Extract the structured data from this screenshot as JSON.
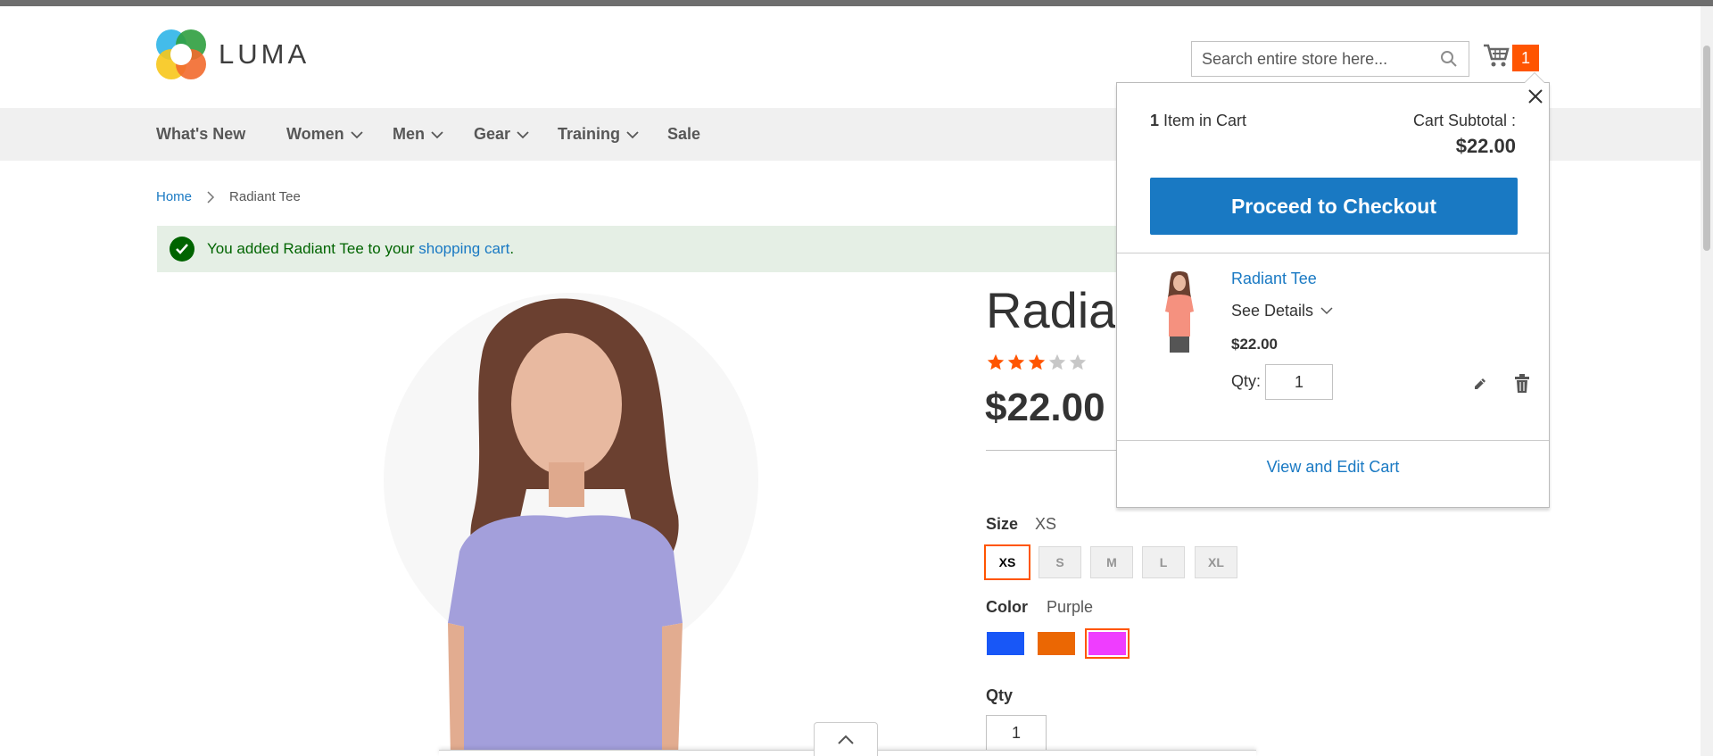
{
  "header": {
    "logo_text": "LUMA",
    "search": {
      "placeholder": "Search entire store here..."
    },
    "cart_count": "1"
  },
  "nav": {
    "items": [
      {
        "label": "What's New",
        "has_dropdown": false
      },
      {
        "label": "Women",
        "has_dropdown": true
      },
      {
        "label": "Men",
        "has_dropdown": true
      },
      {
        "label": "Gear",
        "has_dropdown": true
      },
      {
        "label": "Training",
        "has_dropdown": true
      },
      {
        "label": "Sale",
        "has_dropdown": false
      }
    ]
  },
  "breadcrumb": {
    "home": "Home",
    "current": "Radiant Tee"
  },
  "message": {
    "text_before": "You added Radiant Tee to your ",
    "link": "shopping cart",
    "text_after": "."
  },
  "product": {
    "title": "Radiant Tee",
    "rating": 3,
    "rating_max": 5,
    "price": "$22.00",
    "size_label": "Size",
    "size_selected": "XS",
    "sizes": [
      "XS",
      "S",
      "M",
      "L",
      "XL"
    ],
    "color_label": "Color",
    "color_selected": "Purple",
    "colors": [
      {
        "name": "Blue",
        "hex": "#1857f7"
      },
      {
        "name": "Orange",
        "hex": "#eb6703"
      },
      {
        "name": "Purple",
        "hex": "#ef3dff"
      }
    ],
    "qty_label": "Qty",
    "qty": "1"
  },
  "minicart": {
    "count": "1",
    "count_suffix": "Item in Cart",
    "subtotal_label": "Cart Subtotal :",
    "subtotal": "$22.00",
    "checkout_label": "Proceed to Checkout",
    "item": {
      "name": "Radiant Tee",
      "details_label": "See Details",
      "price": "$22.00",
      "qty_label": "Qty:",
      "qty": "1"
    },
    "view_cart_label": "View and Edit Cart"
  },
  "colors": {
    "accent_orange": "#ff5501",
    "link_blue": "#1979c3",
    "success_green": "#006400",
    "nav_bg": "#f0f0f0"
  }
}
